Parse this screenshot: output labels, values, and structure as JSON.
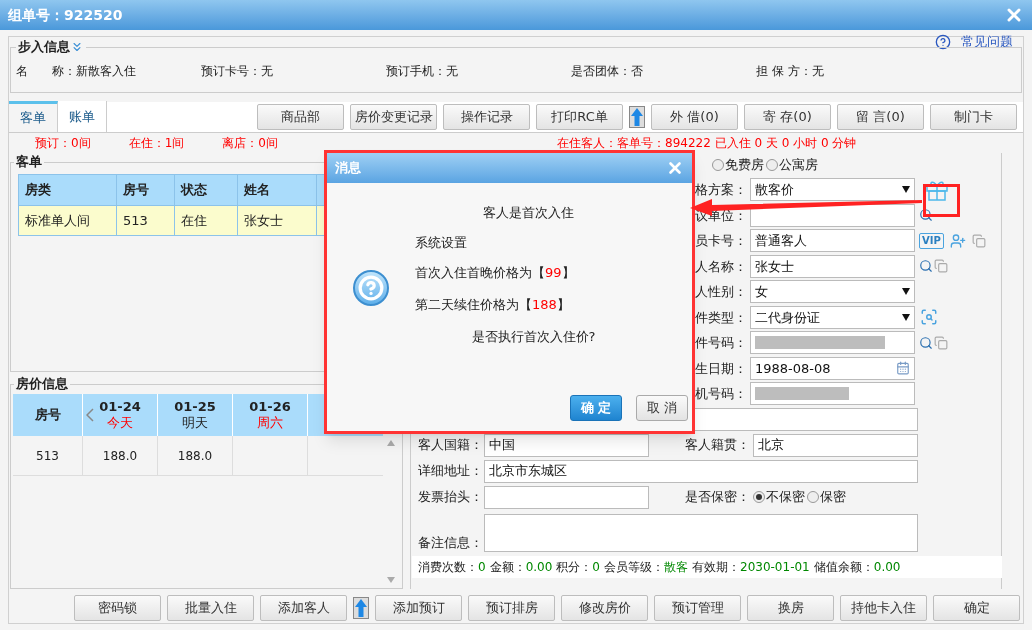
{
  "window": {
    "title": "组单号：922520"
  },
  "help_link": "常见问题",
  "step_info": {
    "legend": "步入信息",
    "fields": [
      {
        "label": "名　　称：",
        "value": "新散客入住"
      },
      {
        "label": "预订卡号：",
        "value": "无"
      },
      {
        "label": "预订手机：",
        "value": "无"
      },
      {
        "label": "是否团体：",
        "value": "否"
      },
      {
        "label": "担 保 方：",
        "value": "无"
      }
    ]
  },
  "tabs": [
    {
      "label": "客单",
      "selected": true
    },
    {
      "label": "账单",
      "selected": false
    }
  ],
  "toolbar": [
    {
      "kind": "button",
      "label": "商品部"
    },
    {
      "kind": "button",
      "label": "房价变更记录"
    },
    {
      "kind": "button",
      "label": "操作记录"
    },
    {
      "kind": "button",
      "label": "打印RC单"
    },
    {
      "kind": "arrow"
    },
    {
      "kind": "button",
      "label": "外 借(0)"
    },
    {
      "kind": "button",
      "label": "寄 存(0)"
    },
    {
      "kind": "button",
      "label": "留 言(0)"
    },
    {
      "kind": "button",
      "label": "制门卡"
    }
  ],
  "counts": [
    "预订：0间",
    "在住：1间",
    "离店：0间"
  ],
  "status_line": "在住客人：客单号：894222 已入住 0 天 0 小时 0 分钟",
  "guest_table": {
    "legend": "客单",
    "columns": [
      "房类",
      "房号",
      "状态",
      "姓名"
    ],
    "rows": [
      {
        "cells": [
          "标准单人间",
          "513",
          "在住",
          "张女士"
        ],
        "selected": true
      }
    ]
  },
  "price_table": {
    "legend": "房价信息",
    "first_column": "房号",
    "dates": [
      {
        "date": "01-24",
        "day": "今天",
        "highlight": true
      },
      {
        "date": "01-25",
        "day": "明天",
        "highlight": false
      },
      {
        "date": "01-26",
        "day": "周六",
        "highlight": true
      }
    ],
    "rows": [
      {
        "cells": [
          "513",
          "188.0",
          "188.0"
        ]
      }
    ]
  },
  "room_types": [
    {
      "label": "免费房",
      "selected": false
    },
    {
      "label": "公寓房",
      "selected": false
    }
  ],
  "form_rows": [
    {
      "kind": "select",
      "label": "格方案：",
      "value": "散客价"
    },
    {
      "kind": "input",
      "label": "议单位："
    },
    {
      "kind": "input",
      "label": "员卡号：",
      "value": "普通客人",
      "badge": "VIP"
    },
    {
      "kind": "input",
      "label": "人名称：",
      "value": "张女士"
    },
    {
      "kind": "select",
      "label": "人性别：",
      "value": "女"
    },
    {
      "kind": "select",
      "label": "件类型：",
      "value": "二代身份证"
    },
    {
      "kind": "masked",
      "label": "件号码："
    },
    {
      "kind": "date",
      "label": "生日期：",
      "value": "1988-08-08"
    },
    {
      "kind": "masked",
      "label": "机号码："
    }
  ],
  "address": {
    "nationality": {
      "label": "客人国籍：",
      "value": "中国"
    },
    "origin": {
      "label": "客人籍贯：",
      "value": "北京"
    },
    "detail": {
      "label": "详细地址：",
      "value": "北京市东城区"
    },
    "invoice": {
      "label": "发票抬头："
    },
    "privacy": {
      "label": "是否保密：",
      "options": [
        {
          "label": "不保密",
          "selected": true
        },
        {
          "label": "保密",
          "selected": false
        }
      ]
    },
    "notes": {
      "label": "备注信息："
    }
  },
  "stats": [
    {
      "label": "消费次数：",
      "value": "0"
    },
    {
      "label": "金额：",
      "value": "0.00"
    },
    {
      "label": "积分：",
      "value": "0"
    },
    {
      "label": "会员等级：",
      "value": "散客"
    },
    {
      "label": "有效期：",
      "value": "2030-01-01"
    },
    {
      "label": "储值余额：",
      "value": "0.00"
    }
  ],
  "bottom_buttons": [
    {
      "kind": "button",
      "label": "密码锁"
    },
    {
      "kind": "button",
      "label": "批量入住"
    },
    {
      "kind": "button",
      "label": "添加客人"
    },
    {
      "kind": "arrow"
    },
    {
      "kind": "button",
      "label": "添加预订"
    },
    {
      "kind": "button",
      "label": "预订排房"
    },
    {
      "kind": "button",
      "label": "修改房价"
    },
    {
      "kind": "button",
      "label": "预订管理"
    },
    {
      "kind": "button",
      "label": "换房"
    },
    {
      "kind": "button",
      "label": "持他卡入住"
    },
    {
      "kind": "button",
      "label": "确定"
    }
  ],
  "dialog": {
    "title": "消息",
    "heading": "客人是首次入住",
    "subtitle": "系统设置",
    "prices": [
      {
        "prefix": "首次入住首晚价格为【",
        "value": "99",
        "suffix": "】"
      },
      {
        "prefix": "第二天续住价格为【",
        "value": "188",
        "suffix": "】"
      }
    ],
    "question": "是否执行首次入住价?",
    "buttons": [
      {
        "label": "确 定",
        "primary": true
      },
      {
        "label": "取 消",
        "primary": false
      }
    ]
  }
}
